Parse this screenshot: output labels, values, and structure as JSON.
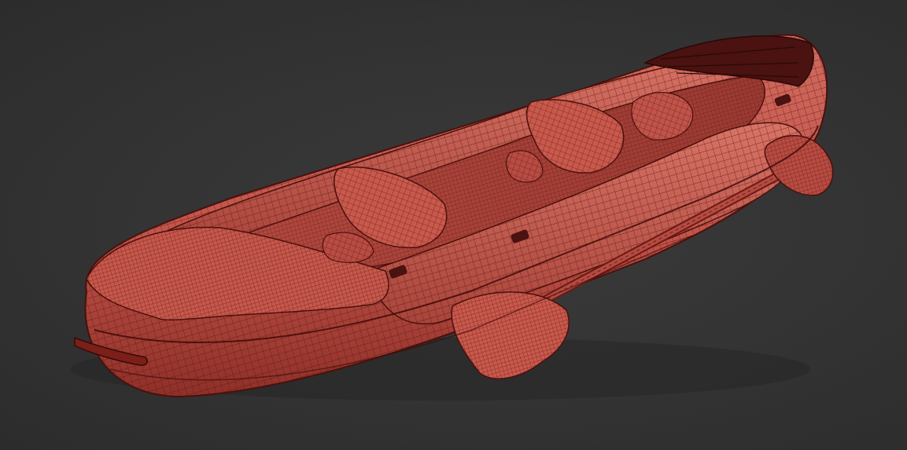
{
  "viewport": {
    "background_color": "#323232",
    "model": {
      "kind": "inflatable kayak wireframe render",
      "base_color": "#c2544a",
      "wire_color": "#5a1410",
      "shadow_color": "#3a0d0a"
    }
  }
}
